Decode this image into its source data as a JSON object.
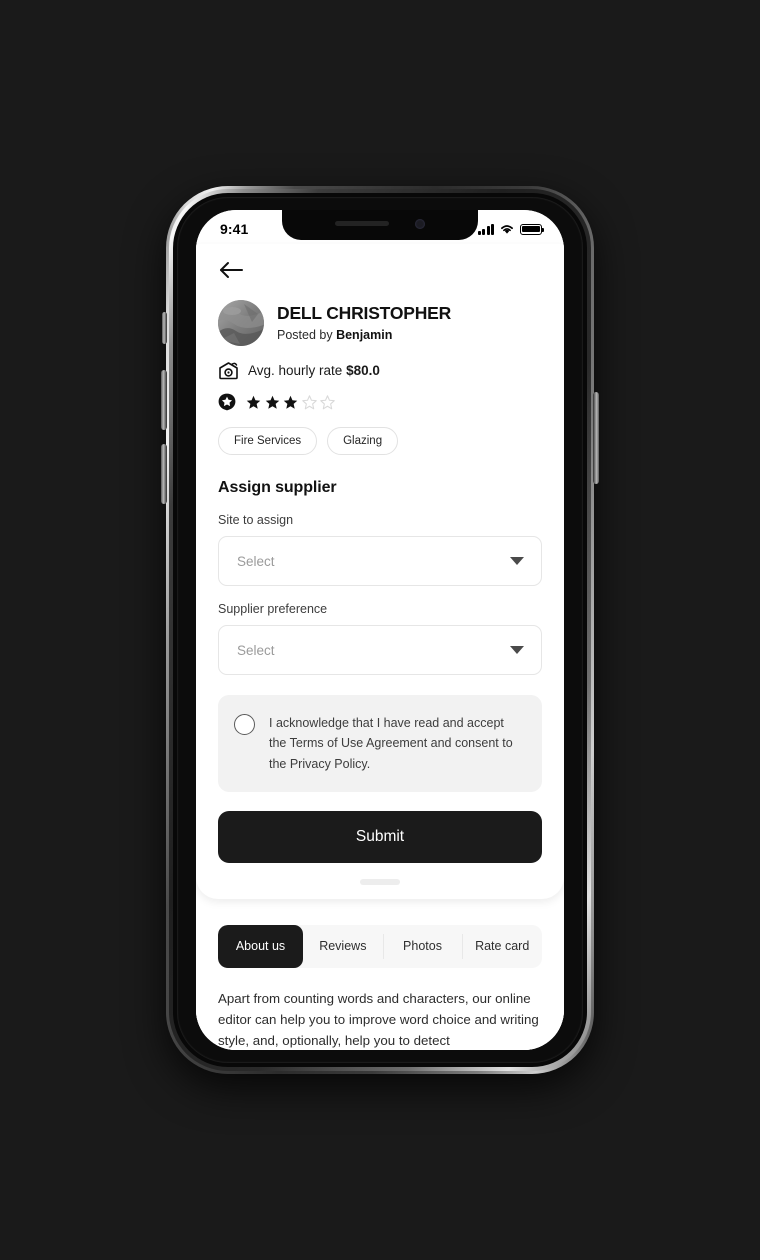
{
  "device": {
    "status_bar": {
      "time": "9:41",
      "icons": [
        "cellular-signal-icon",
        "wifi-icon",
        "battery-icon"
      ]
    }
  },
  "screen": {
    "nav": {
      "back_icon": "arrow-left-icon"
    },
    "profile": {
      "avatar_alt": "avatar",
      "name": "DELL CHRISTOPHER",
      "posted_by_prefix": "Posted by ",
      "posted_by_name": "Benjamin"
    },
    "rate": {
      "icon": "money-icon",
      "label": "Avg. hourly rate ",
      "value": "$80.0"
    },
    "rating": {
      "icon": "star-badge-icon",
      "filled": 3,
      "total": 5
    },
    "tags": [
      "Fire Services",
      "Glazing"
    ],
    "form": {
      "title": "Assign supplier",
      "fields": [
        {
          "label": "Site to assign",
          "value": "Select",
          "placeholder": "Select",
          "caret_icon": "chevron-down-icon"
        },
        {
          "label": "Supplier preference",
          "value": "Select",
          "placeholder": "Select",
          "caret_icon": "chevron-down-icon"
        }
      ],
      "consent": {
        "checked": false,
        "text": "I acknowledge that I have read and accept the Terms of Use Agreement and consent to the Privacy Policy."
      },
      "submit_label": "Submit"
    },
    "tabs": [
      {
        "label": "About us",
        "active": true
      },
      {
        "label": "Reviews",
        "active": false
      },
      {
        "label": "Photos",
        "active": false
      },
      {
        "label": "Rate card",
        "active": false
      }
    ],
    "body_copy": "Apart from counting words and characters, our online editor can help you to improve word choice and writing style, and, optionally, help you to detect"
  },
  "colors": {
    "page_background": "#1a1a1a",
    "screen_background": "#ffffff",
    "accent_dark": "#1b1b1b",
    "muted_text": "#9b9b9b",
    "panel_gray": "#f2f2f2",
    "tabbar_gray": "#f7f7f7"
  }
}
